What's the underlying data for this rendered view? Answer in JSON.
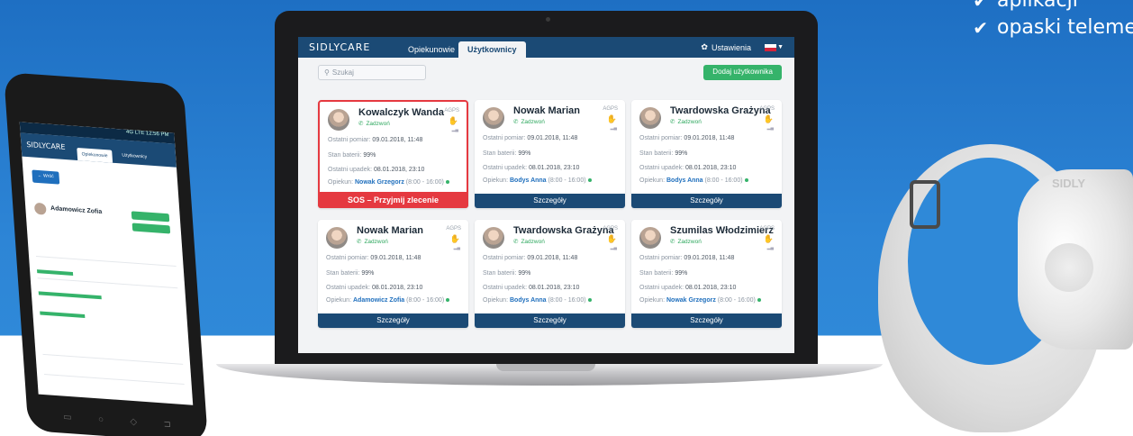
{
  "promo": {
    "items": [
      {
        "check_icon": "check-icon",
        "text": "aplikacji"
      },
      {
        "check_icon": "check-icon",
        "text": "opaski teleme"
      }
    ]
  },
  "app": {
    "logo": "SIDLYCARE",
    "tabs": [
      "Opiekunowie",
      "Użytkownicy"
    ],
    "active_tab": "Użytkownicy",
    "settings_label": "Ustawienia",
    "search_placeholder": "Szukaj",
    "add_user_label": "Dodaj użytkownika",
    "labels": {
      "call": "Zadzwoń",
      "agps": "AGPS",
      "last_measure": "Ostatni pomiar:",
      "battery": "Stan baterii:",
      "last_fall": "Ostatni upadek:",
      "caregiver": "Opiekun:",
      "details": "Szczegóły",
      "sos": "SOS – Przyjmij zlecenie"
    },
    "cards": [
      {
        "name": "Kowalczyk Wanda",
        "measure": "09.01.2018, 11:48",
        "battery": "99%",
        "fall": "08.01.2018, 23:10",
        "caregiver": "Nowak Grzegorz",
        "hours": "(8:00 - 16:00)",
        "hand": "green",
        "sos": true
      },
      {
        "name": "Nowak Marian",
        "measure": "09.01.2018, 11:48",
        "battery": "99%",
        "fall": "08.01.2018, 23:10",
        "caregiver": "Bodys Anna",
        "hours": "(8:00 - 16:00)",
        "hand": "green",
        "sos": false
      },
      {
        "name": "Twardowska Grażyna",
        "measure": "09.01.2018, 11:48",
        "battery": "99%",
        "fall": "08.01.2018, 23:10",
        "caregiver": "Bodys Anna",
        "hours": "(8:00 - 16:00)",
        "hand": "red",
        "sos": false
      },
      {
        "name": "Nowak Marian",
        "measure": "09.01.2018, 11:48",
        "battery": "99%",
        "fall": "08.01.2018, 23:10",
        "caregiver": "Adamowicz Zofia",
        "hours": "(8:00 - 16:00)",
        "hand": "green",
        "sos": false
      },
      {
        "name": "Twardowska Grażyna",
        "measure": "09.01.2018, 11:48",
        "battery": "99%",
        "fall": "08.01.2018, 23:10",
        "caregiver": "Bodys Anna",
        "hours": "(8:00 - 16:00)",
        "hand": "red",
        "sos": false
      },
      {
        "name": "Szumilas Włodzimierz",
        "measure": "09.01.2018, 11:48",
        "battery": "99%",
        "fall": "08.01.2018, 23:10",
        "caregiver": "Nowak Grzegorz",
        "hours": "(8:00 - 16:00)",
        "hand": "green",
        "sos": false
      }
    ]
  },
  "phone": {
    "status": "4G LTE 12:56 PM",
    "logo": "SIDLYCARE",
    "tabs": [
      "Opiekunowie",
      "Użytkownicy"
    ],
    "back_label": "← Wróć",
    "user_name": "Adamowicz Zofia"
  },
  "band": {
    "logo": "SIDLY"
  },
  "colors": {
    "navy": "#1b4a75",
    "green": "#35b36a",
    "red": "#e53940",
    "bg_blue": "#2d85d6"
  }
}
